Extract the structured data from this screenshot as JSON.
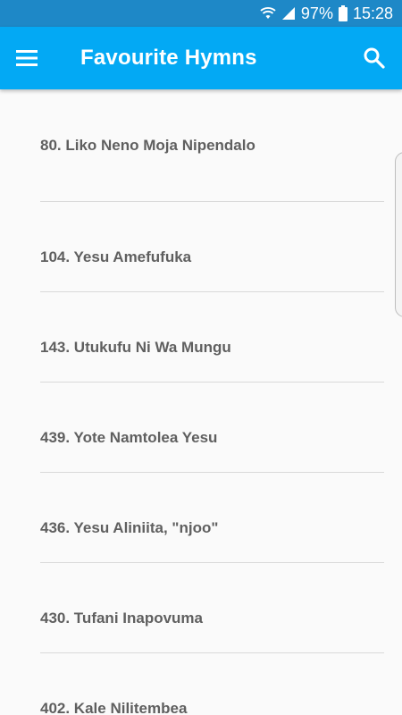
{
  "status_bar": {
    "battery": "97%",
    "time": "15:28",
    "icons": [
      "wifi-icon",
      "signal-icon",
      "battery-icon"
    ]
  },
  "app_bar": {
    "title": "Favourite Hymns",
    "menu_icon": "hamburger-menu-icon",
    "search_icon": "search-icon",
    "color": "#03a9f4"
  },
  "hymns": [
    {
      "label": "80. Liko Neno Moja Nipendalo"
    },
    {
      "label": "104. Yesu Amefufuka"
    },
    {
      "label": "143. Utukufu Ni Wa Mungu"
    },
    {
      "label": "439. Yote Namtolea Yesu"
    },
    {
      "label": "436. Yesu Aliniita, \"njoo\""
    },
    {
      "label": "430. Tufani Inapovuma"
    },
    {
      "label": "402. Kale Nilitembea"
    }
  ]
}
